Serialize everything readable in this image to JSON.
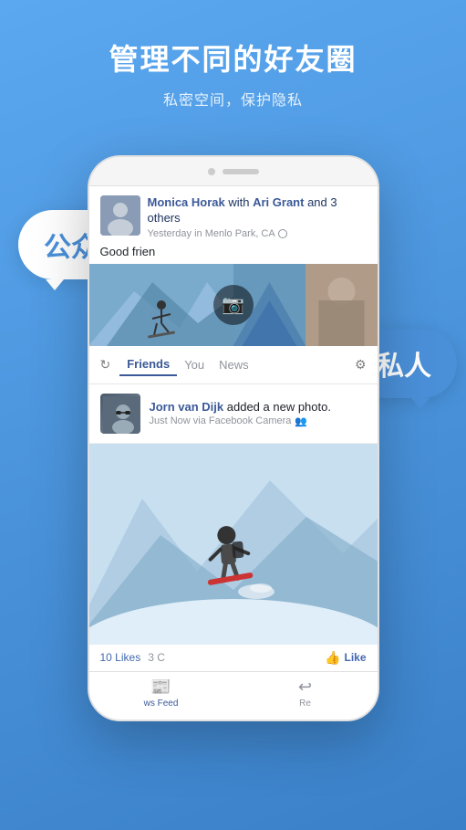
{
  "background": {
    "color": "#4A90D9"
  },
  "title": {
    "main": "管理不同的好友圈",
    "sub": "私密空间，保护隐私"
  },
  "bubbles": {
    "public": "公众",
    "private": "私人"
  },
  "phone": {
    "post": {
      "author": "Monica Horak",
      "coauthor": "Ari Grant",
      "others": "and 3 others",
      "time": "Yesterday in Menlo Park, CA",
      "preview_text": "Good frien"
    },
    "tabs": {
      "refresh_label": "↻",
      "items": [
        "Friends",
        "You",
        "News"
      ],
      "gear_label": "⚙"
    },
    "notification": {
      "name": "Jorn van Dijk",
      "action": "added a new photo.",
      "time": "Just Now via Facebook Camera",
      "icon": "👥"
    },
    "likes": {
      "count": "10 Likes",
      "comments": "3 C",
      "like_label": "Like"
    },
    "bottom_nav": [
      {
        "label": "ws Feed",
        "icon": "≡"
      },
      {
        "label": "Re",
        "icon": "↩"
      }
    ]
  }
}
